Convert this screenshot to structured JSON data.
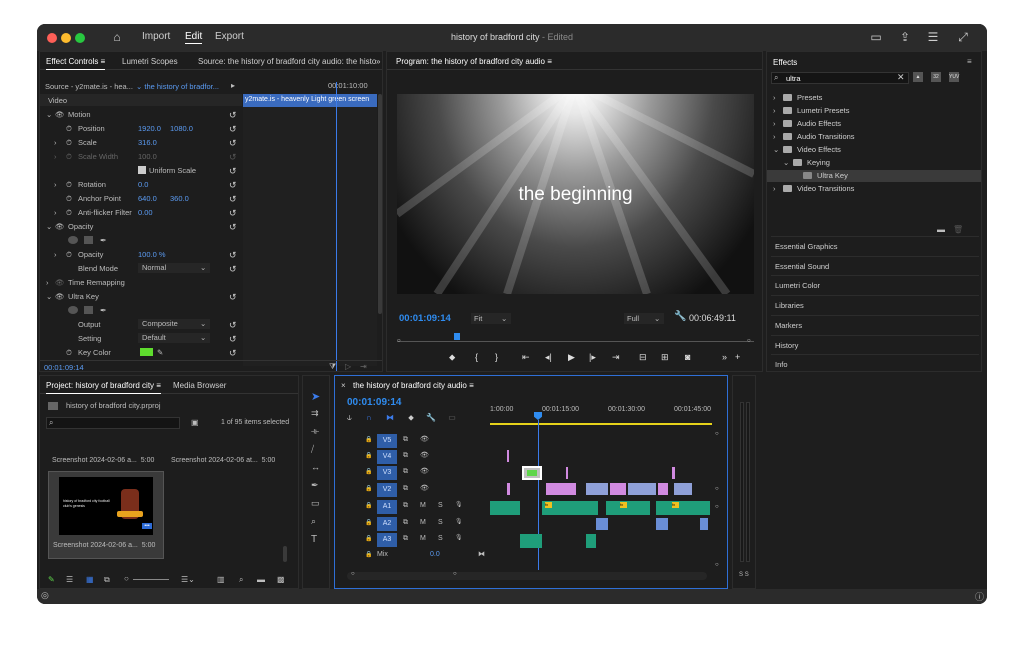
{
  "window": {
    "title": "history of bradford city",
    "title_status": "- Edited",
    "workspaces": [
      "Import",
      "Edit",
      "Export"
    ],
    "active_workspace": "Edit"
  },
  "effect_controls": {
    "tabs": [
      "Effect Controls",
      "Lumetri Scopes",
      "Source: the history of bradford city audio: the histo"
    ],
    "source": "Source - y2mate.is - hea...",
    "sequence": "the history of bradfor...",
    "timecode_head": "00:01:10:00",
    "section": "Video",
    "clip_label": "y2mate.is - heavenly Light green screen",
    "motion": "Motion",
    "position_label": "Position",
    "position_x": "1920.0",
    "position_y": "1080.0",
    "scale_label": "Scale",
    "scale": "316.0",
    "scale_width_label": "Scale Width",
    "scale_width": "100.0",
    "uniform_scale": "Uniform Scale",
    "rotation_label": "Rotation",
    "rotation": "0.0",
    "anchor_label": "Anchor Point",
    "anchor_x": "640.0",
    "anchor_y": "360.0",
    "flicker_label": "Anti-flicker Filter",
    "flicker": "0.00",
    "opacity_section": "Opacity",
    "opacity_label": "Opacity",
    "opacity": "100.0 %",
    "blend_label": "Blend Mode",
    "blend": "Normal",
    "time_remap": "Time Remapping",
    "ultra_key": "Ultra Key",
    "output_label": "Output",
    "output": "Composite",
    "setting_label": "Setting",
    "setting": "Default",
    "key_color_label": "Key Color",
    "bottom_tc": "00:01:09:14"
  },
  "program": {
    "title": "Program: the history of bradford city audio",
    "overlay_text": "the beginning",
    "timecode": "00:01:09:14",
    "fit": "Fit",
    "quality": "Full",
    "duration": "00:06:49:11"
  },
  "effects": {
    "title": "Effects",
    "search": "ultra",
    "tree": [
      {
        "label": "Presets",
        "indent": 0,
        "kind": "folder-star"
      },
      {
        "label": "Lumetri Presets",
        "indent": 0,
        "kind": "folder-star"
      },
      {
        "label": "Audio Effects",
        "indent": 0,
        "kind": "folder"
      },
      {
        "label": "Audio Transitions",
        "indent": 0,
        "kind": "folder"
      },
      {
        "label": "Video Effects",
        "indent": 0,
        "kind": "folder",
        "open": true
      },
      {
        "label": "Keying",
        "indent": 1,
        "kind": "folder",
        "open": true
      },
      {
        "label": "Ultra Key",
        "indent": 2,
        "kind": "effect",
        "selected": true
      },
      {
        "label": "Video Transitions",
        "indent": 0,
        "kind": "folder"
      }
    ],
    "panels": [
      "Essential Graphics",
      "Essential Sound",
      "Lumetri Color",
      "Libraries",
      "Markers",
      "History",
      "Info"
    ]
  },
  "project": {
    "tabs": [
      "Project: history of bradford city",
      "Media Browser"
    ],
    "file": "history of bradford city.prproj",
    "count": "1 of 95 items selected",
    "items": [
      "Screenshot 2024-02-06 a...",
      "Screenshot 2024-02-06 at...",
      "Screenshot 2024-02-06 a..."
    ],
    "item_durations": [
      "5:00",
      "5:00",
      "5:00"
    ],
    "thumb_text": "history of bradford city football club's genesis"
  },
  "timeline": {
    "title": "the history of bradford city audio",
    "timecode": "00:01:09:14",
    "ruler": [
      "1:00:00",
      "00:01:15:00",
      "00:01:30:00",
      "00:01:45:00"
    ],
    "video_tracks": [
      "V5",
      "V4",
      "V3",
      "V2"
    ],
    "audio_tracks": [
      "A1",
      "A2",
      "A3"
    ],
    "mix_label": "Mix",
    "mix_value": "0.0",
    "mute": "M",
    "solo": "S"
  },
  "meter": {
    "labels": [
      "S",
      "S"
    ]
  }
}
